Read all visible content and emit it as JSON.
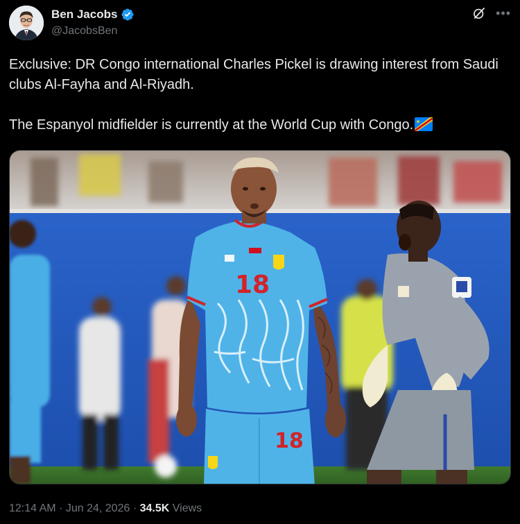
{
  "author": {
    "display_name": "Ben Jacobs",
    "handle": "@JacobsBen",
    "verified": true
  },
  "tweet": {
    "line1": "Exclusive: DR Congo international Charles Pickel is drawing interest from Saudi clubs Al-Fayha and Al-Riyadh.",
    "line2": "The Espanyol midfielder is currently at the World Cup with Congo.",
    "flag_emoji": "DR Congo flag"
  },
  "media": {
    "player_number": "18",
    "shorts_number": "18"
  },
  "meta": {
    "time": "12:14 AM",
    "separator": "·",
    "date": "Jun 24, 2026",
    "views_count": "34.5K",
    "views_label": "Views"
  },
  "icons": {
    "verified": "verified-badge-icon",
    "grok": "grok-icon",
    "more": "more-icon"
  },
  "colors": {
    "background": "#000000",
    "text_primary": "#e7e9ea",
    "text_secondary": "#71767b",
    "verified_blue": "#1d9bf0",
    "jersey_blue": "#4fb3e8"
  }
}
